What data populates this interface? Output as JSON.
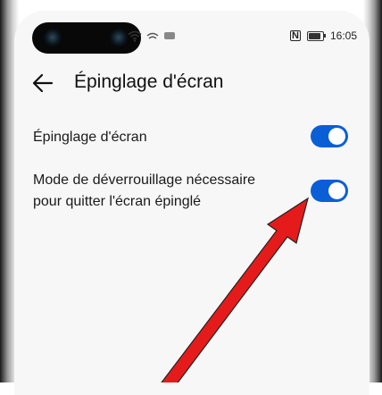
{
  "status_bar": {
    "time": "16:05",
    "battery_level": 0.85,
    "icons": [
      "wifi-icon",
      "signal-icon",
      "nfc-icon",
      "battery-icon"
    ]
  },
  "header": {
    "title": "Épinglage d'écran",
    "back_icon": "arrow-left-icon"
  },
  "settings": [
    {
      "label": "Épinglage d'écran",
      "enabled": true
    },
    {
      "label_line1": "Mode de déverrouillage nécessaire",
      "label_line2": "pour quitter l'écran épinglé",
      "enabled": true
    }
  ],
  "colors": {
    "accent": "#0a5fd6",
    "annotation_arrow": "#e51b1b"
  }
}
